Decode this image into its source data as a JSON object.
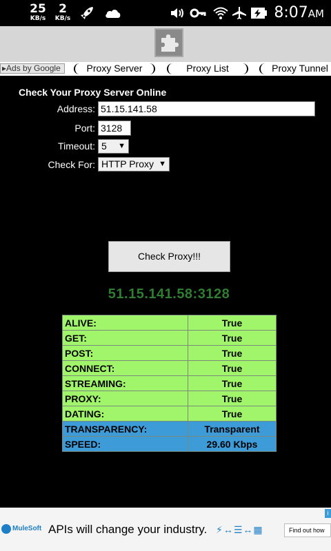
{
  "status_bar": {
    "down_speed": "25",
    "down_unit": "KB/s",
    "up_speed": "2",
    "up_unit": "KB/s",
    "time": "8:07",
    "ampm": "AM"
  },
  "ads_bar": {
    "ads_by": "Ads by Google",
    "links": [
      "Proxy Server",
      "Proxy List",
      "Proxy Tunnel"
    ]
  },
  "form": {
    "title": "Check Your Proxy Server Online",
    "address_label": "Address:",
    "address_value": "51.15.141.58",
    "port_label": "Port:",
    "port_value": "3128",
    "timeout_label": "Timeout:",
    "timeout_value": "5",
    "checkfor_label": "Check For:",
    "checkfor_value": "HTTP Proxy",
    "check_button": "Check Proxy!!!"
  },
  "result": {
    "host": "51.15.141.58:3128",
    "rows": [
      {
        "key": "ALIVE:",
        "value": "True"
      },
      {
        "key": "GET:",
        "value": "True"
      },
      {
        "key": "POST:",
        "value": "True"
      },
      {
        "key": "CONNECT:",
        "value": "True"
      },
      {
        "key": "STREAMING:",
        "value": "True"
      },
      {
        "key": "PROXY:",
        "value": "True"
      },
      {
        "key": "DATING:",
        "value": "True"
      },
      {
        "key": "TRANSPARENCY:",
        "value": "Transparent"
      },
      {
        "key": "SPEED:",
        "value": "29.60 Kbps"
      }
    ]
  },
  "bottom_ad": {
    "brand": "MuleSoft",
    "text": "APIs will change your industry.",
    "cta": "Find out how"
  },
  "colors": {
    "row_green": "#a0f56a",
    "row_blue": "#3d9bd8",
    "host_green": "#2e7d32"
  }
}
